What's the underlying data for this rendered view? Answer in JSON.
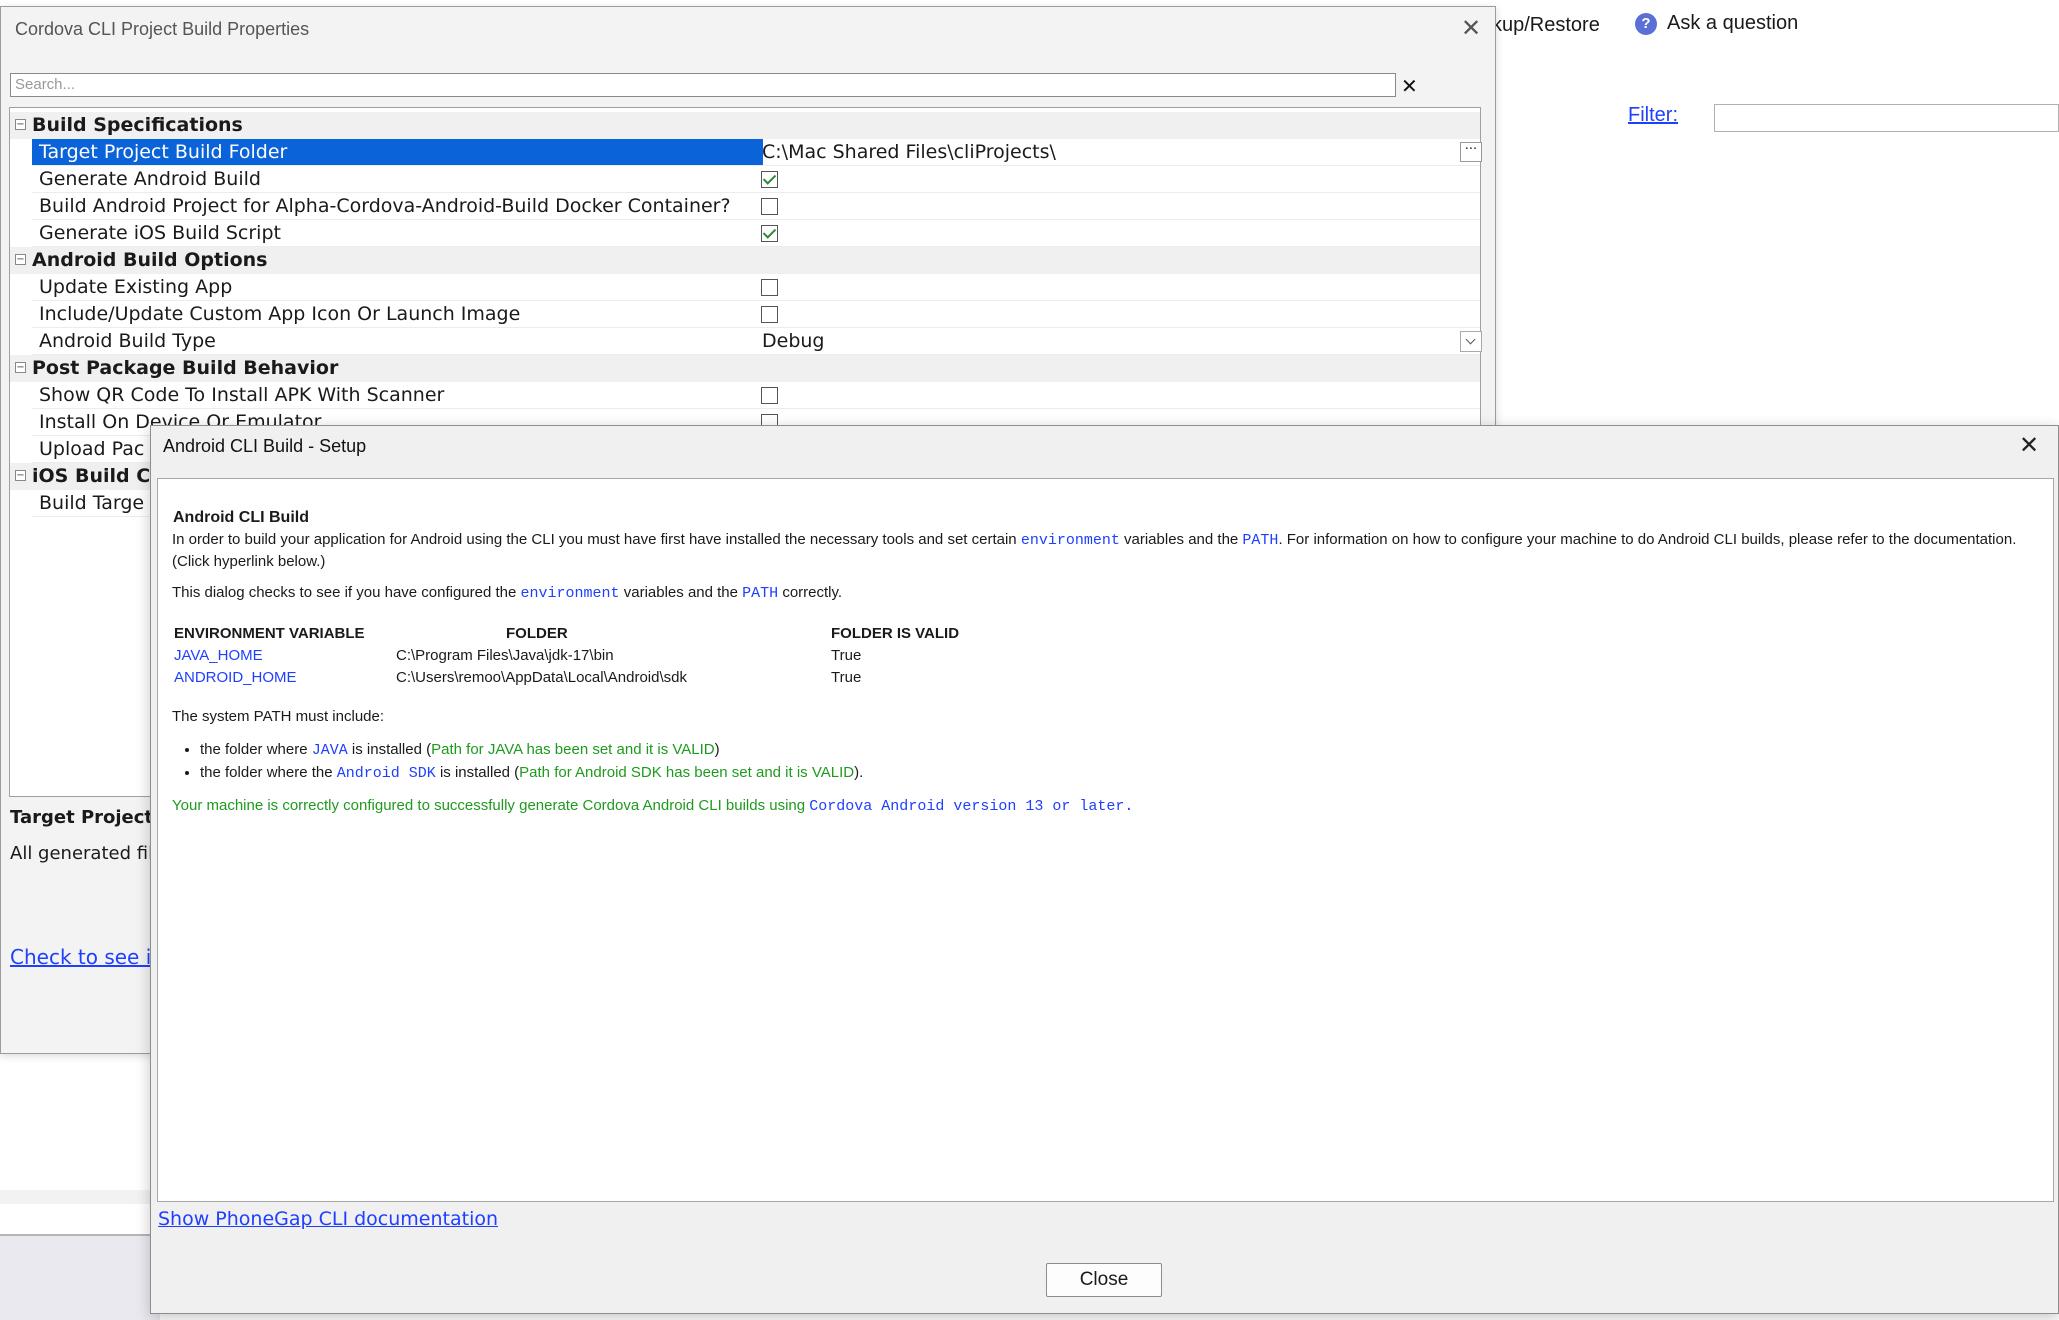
{
  "background_app": {
    "backup_restore_label": "kup/Restore",
    "ask_question_label": "Ask a question",
    "filter_label": "Filter:"
  },
  "properties_window": {
    "title": "Cordova CLI Project Build Properties",
    "search_placeholder": "Search...",
    "categories": [
      {
        "label": "Build Specifications",
        "items": [
          {
            "name": "Target Project Build Folder",
            "value": "C:\\Mac Shared Files\\cliProjects\\",
            "selected": true
          },
          {
            "name": "Generate Android Build",
            "checked": true
          },
          {
            "name": "Build Android Project for Alpha-Cordova-Android-Build Docker Container?",
            "checked": false
          },
          {
            "name": "Generate iOS Build Script",
            "checked": true
          }
        ]
      },
      {
        "label": "Android Build Options",
        "items": [
          {
            "name": "Update Existing App",
            "checked": false
          },
          {
            "name": "Include/Update Custom App Icon Or Launch Image",
            "checked": false
          },
          {
            "name": "Android Build Type",
            "value": "Debug"
          }
        ]
      },
      {
        "label": "Post Package Build Behavior",
        "items": [
          {
            "name": "Show QR Code To Install APK With Scanner",
            "checked": false
          },
          {
            "name": "Install On Device Or Emulator",
            "checked": false
          },
          {
            "name": "Upload Pac"
          }
        ]
      },
      {
        "label": "iOS Build C",
        "items": [
          {
            "name": "Build Targe"
          }
        ]
      }
    ],
    "description_title": "Target Project",
    "description_text": "All generated file",
    "description_link": "Check to see i"
  },
  "setup_dialog": {
    "title": "Android CLI Build - Setup",
    "heading": "Android CLI Build",
    "intro": {
      "t1": "In order to build your application for Android using the CLI you must have first have installed the necessary tools and set certain ",
      "code1": "environment",
      "t2": " variables and the ",
      "code2": "PATH",
      "t3": ". For information on how to configure your machine to do Android CLI builds, please refer to the documentation. (Click hyperlink below.)"
    },
    "check": {
      "t1": "This dialog checks to see if you have configured the ",
      "code1": "environment",
      "t2": " variables and the ",
      "code2": "PATH",
      "t3": " correctly."
    },
    "table": {
      "headers": [
        "ENVIRONMENT VARIABLE",
        "FOLDER",
        "FOLDER IS VALID"
      ],
      "rows": [
        {
          "var": "JAVA_HOME",
          "folder": "C:\\Program Files\\Java\\jdk-17\\bin",
          "valid": "True"
        },
        {
          "var": "ANDROID_HOME",
          "folder": "C:\\Users\\remoo\\AppData\\Local\\Android\\sdk",
          "valid": "True"
        }
      ]
    },
    "path_intro": "The system PATH must include:",
    "bullets": [
      {
        "t1": "the folder where ",
        "code": "JAVA",
        "t2": " is installed (",
        "status": "Path for JAVA has been set and it is VALID",
        "t3": ")"
      },
      {
        "t1": "the folder where the ",
        "code": "Android SDK",
        "t2": " is installed (",
        "status": "Path for Android SDK has been set and it is VALID",
        "t3": ")."
      }
    ],
    "success": {
      "text": "Your machine is correctly configured to successfully generate Cordova Android CLI builds using ",
      "code": "Cordova Android version 13 or later."
    },
    "doc_link": "Show PhoneGap CLI documentation",
    "close_label": "Close"
  },
  "colors": {
    "link_blue": "#1f3fff",
    "selection_blue": "#0a63d8",
    "success_green": "#1e9a1e"
  }
}
